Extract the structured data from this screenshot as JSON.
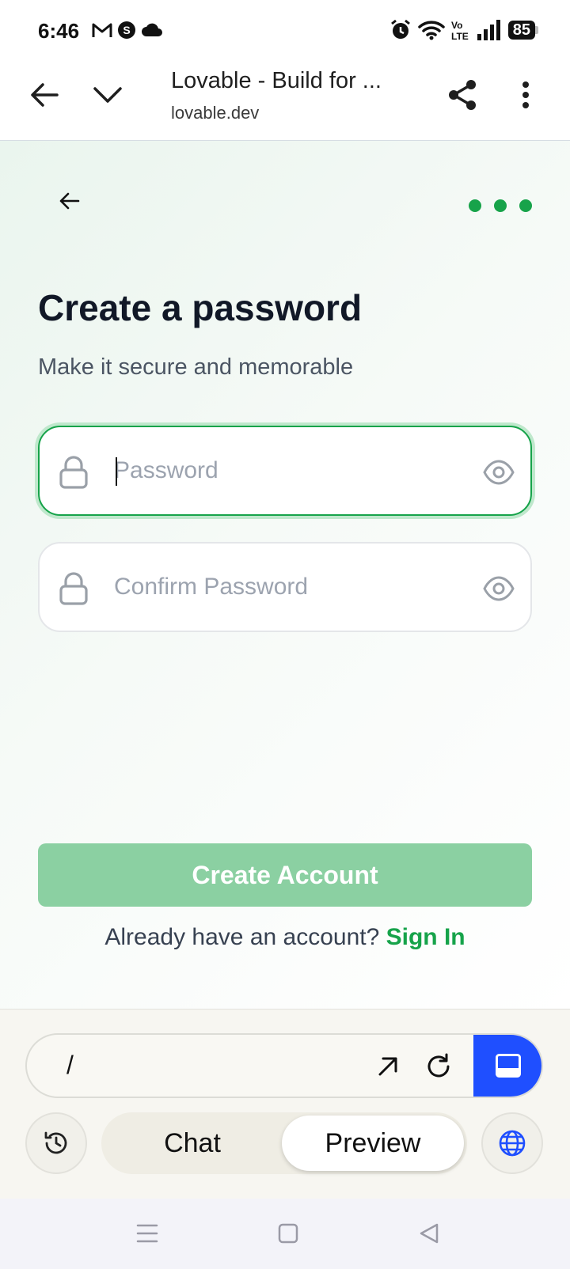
{
  "status_bar": {
    "time": "6:46",
    "battery": "85",
    "icons": [
      "gmail-icon",
      "s-app-icon",
      "cloud-icon",
      "alarm-icon",
      "wifi-icon",
      "volte-icon",
      "signal-icon",
      "battery-icon"
    ]
  },
  "browser": {
    "title": "Lovable - Build for ...",
    "url": "lovable.dev"
  },
  "page": {
    "heading": "Create a password",
    "subheading": "Make it secure and memorable",
    "password_placeholder": "Password",
    "password_value": "",
    "confirm_placeholder": "Confirm Password",
    "confirm_value": "",
    "create_button": "Create Account",
    "signin_prompt": "Already have an account?",
    "signin_link": "Sign In",
    "progress_steps_completed": 3,
    "progress_steps_total": 3
  },
  "app_bar": {
    "path": "/",
    "tabs": [
      {
        "label": "Chat",
        "active": false
      },
      {
        "label": "Preview",
        "active": true
      }
    ]
  },
  "colors": {
    "accent_green": "#16a34a",
    "button_disabled_green": "#8bd0a2",
    "view_button_blue": "#1f4fff"
  }
}
